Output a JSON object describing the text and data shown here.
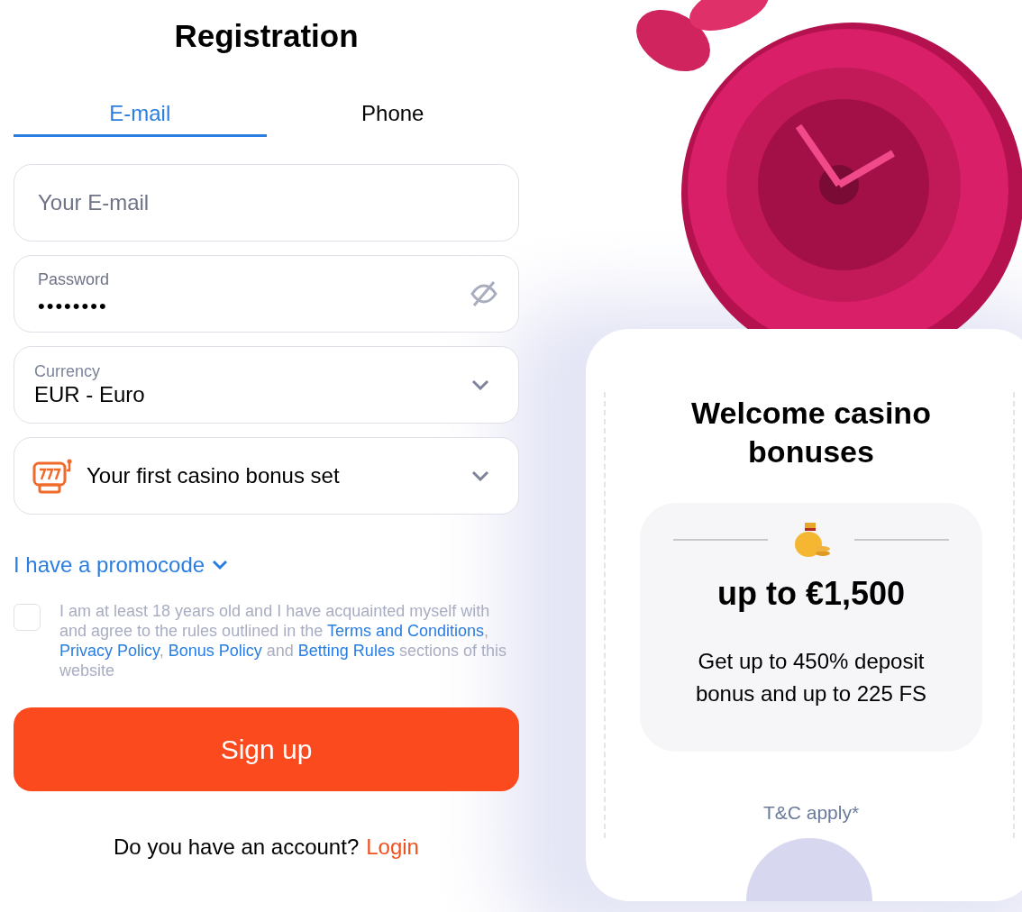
{
  "title": "Registration",
  "tabs": [
    {
      "label": "E-mail",
      "selected": true
    },
    {
      "label": "Phone",
      "selected": false
    }
  ],
  "fields": [
    {
      "kind": "input",
      "placeholder": "Your E-mail"
    },
    {
      "kind": "password",
      "label": "Password",
      "value": "••••••••"
    },
    {
      "kind": "select",
      "label": "Currency",
      "value": "EUR - Euro"
    },
    {
      "kind": "bonus",
      "value": "Your first casino bonus set"
    }
  ],
  "promocode": {
    "label": "I have a promocode",
    "expanded": false
  },
  "consent": {
    "checked": false,
    "parts": [
      {
        "kind": "text",
        "text": "I am at least 18 years old and I have acquainted myself with and agree to the rules outlined in the "
      },
      {
        "kind": "link",
        "text": "Terms and Conditions"
      },
      {
        "kind": "text",
        "text": ", "
      },
      {
        "kind": "link",
        "text": "Privacy Policy"
      },
      {
        "kind": "text",
        "text": ", "
      },
      {
        "kind": "link",
        "text": "Bonus Policy"
      },
      {
        "kind": "text",
        "text": " and "
      },
      {
        "kind": "link",
        "text": "Betting Rules"
      },
      {
        "kind": "text",
        "text": " sections of this website"
      }
    ]
  },
  "submit": "Sign up",
  "account_prompt": {
    "text": "Do you have an account?",
    "link": "Login"
  },
  "promo_card": {
    "title": "Welcome casino bonuses",
    "amount": "up to €1,500",
    "description": "Get up to 450% deposit bonus and up to 225 FS",
    "terms": "T&C apply*"
  }
}
